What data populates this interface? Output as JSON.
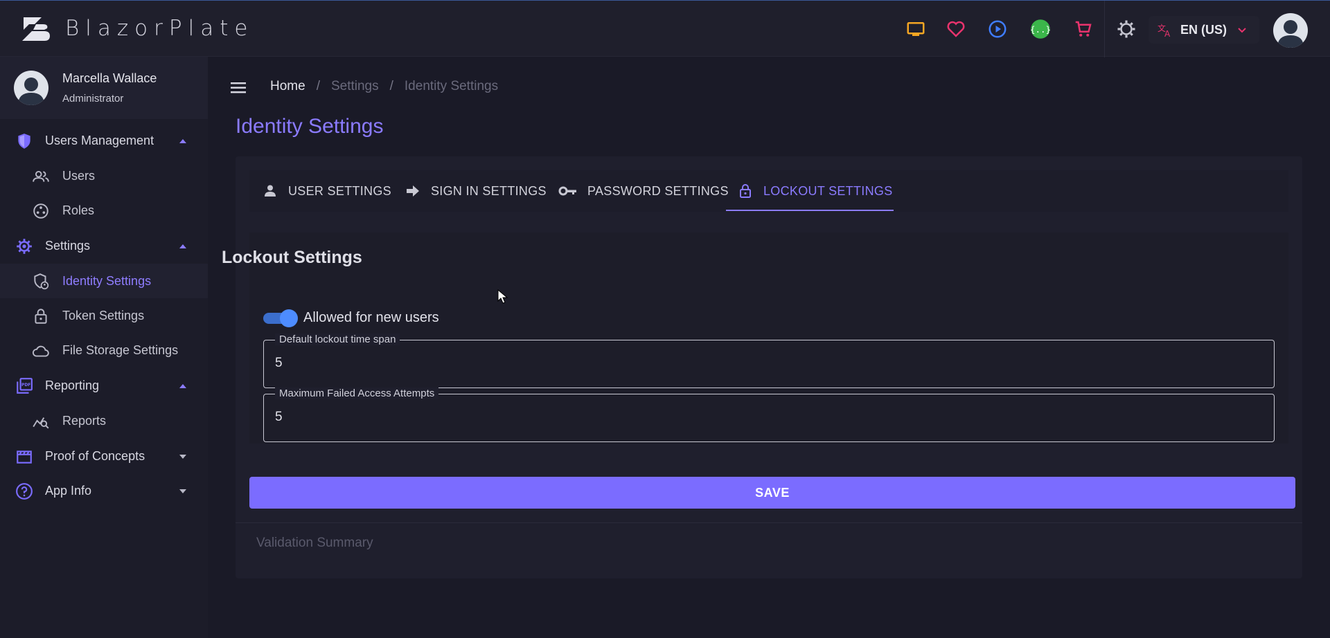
{
  "brand": {
    "name": "BlazorPlate"
  },
  "topbar": {
    "icons": [
      "monitor-icon",
      "heart-icon",
      "play-circle-icon",
      "api-icon",
      "cart-icon",
      "theme-gear-icon"
    ],
    "language": "EN (US)",
    "colors": {
      "monitor": "#f5a623",
      "heart": "#e8336d",
      "play": "#3f7dff",
      "api_bg": "#3bb54a",
      "cart": "#e8336d",
      "accent": "#8b7bff"
    }
  },
  "profile": {
    "name": "Marcella Wallace",
    "role": "Administrator"
  },
  "sidebar": {
    "groups": [
      {
        "label": "Users Management",
        "icon": "shield-icon",
        "expanded": true,
        "items": [
          {
            "label": "Users",
            "icon": "users-icon"
          },
          {
            "label": "Roles",
            "icon": "roles-icon"
          }
        ]
      },
      {
        "label": "Settings",
        "icon": "settings-gear-icon",
        "expanded": true,
        "items": [
          {
            "label": "Identity Settings",
            "icon": "identity-icon",
            "active": true
          },
          {
            "label": "Token Settings",
            "icon": "lock-icon"
          },
          {
            "label": "File Storage Settings",
            "icon": "cloud-icon"
          }
        ]
      },
      {
        "label": "Reporting",
        "icon": "pdf-icon",
        "expanded": true,
        "items": [
          {
            "label": "Reports",
            "icon": "chart-search-icon"
          }
        ]
      },
      {
        "label": "Proof of Concepts",
        "icon": "film-icon",
        "expanded": false
      },
      {
        "label": "App Info",
        "icon": "help-icon",
        "expanded": false
      }
    ]
  },
  "breadcrumb": {
    "home": "Home",
    "settings": "Settings",
    "current": "Identity Settings",
    "separator": "/"
  },
  "page": {
    "title": "Identity Settings"
  },
  "tabs": [
    {
      "label": "USER SETTINGS",
      "icon": "person-icon"
    },
    {
      "label": "SIGN IN SETTINGS",
      "icon": "arrow-right-icon"
    },
    {
      "label": "PASSWORD SETTINGS",
      "icon": "key-icon"
    },
    {
      "label": "LOCKOUT SETTINGS",
      "icon": "lock-open-icon",
      "active": true
    }
  ],
  "lockout": {
    "title": "Lockout Settings",
    "allowed_for_new_users": {
      "label": "Allowed for new users",
      "checked": true
    },
    "default_lockout_time_span": {
      "label": "Default lockout time span",
      "value": "5"
    },
    "max_failed_access_attempts": {
      "label": "Maximum Failed Access Attempts",
      "value": "5"
    }
  },
  "actions": {
    "save": "SAVE"
  },
  "validation": {
    "summary": "Validation Summary"
  }
}
